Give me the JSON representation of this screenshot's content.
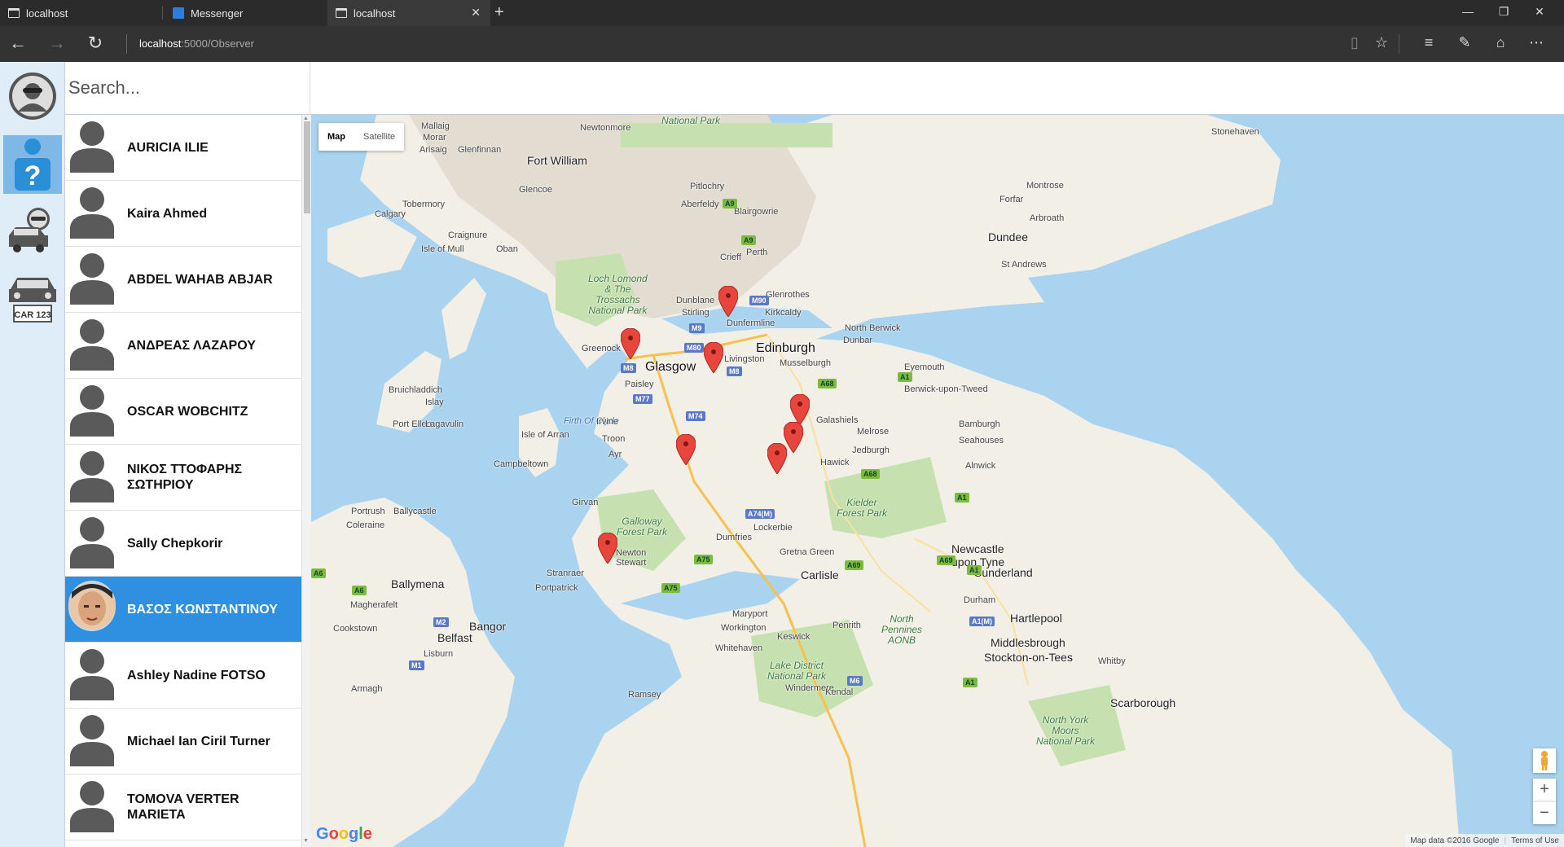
{
  "browser": {
    "tabs": [
      {
        "title": "localhost",
        "active": false
      },
      {
        "title": "Messenger",
        "active": false
      },
      {
        "title": "localhost",
        "active": true
      }
    ],
    "url_host": "localhost",
    "url_path": ":5000/Observer"
  },
  "search": {
    "placeholder": "Search..."
  },
  "rail": [
    {
      "icon": "masked-user-icon",
      "active": false
    },
    {
      "icon": "unknown-person-icon",
      "active": true
    },
    {
      "icon": "driver-car-icon",
      "active": false
    },
    {
      "icon": "car-plate-icon",
      "active": false,
      "plate": "CAR 123"
    }
  ],
  "people": [
    {
      "name": "AURICIA ILIE",
      "selected": false
    },
    {
      "name": "Kaira Ahmed",
      "selected": false
    },
    {
      "name": "ABDEL WAHAB ABJAR",
      "selected": false
    },
    {
      "name": "ΑΝΔΡΕΑΣ ΛΑΖΑΡΟΥ",
      "selected": false
    },
    {
      "name": "OSCAR WOBCHITZ",
      "selected": false
    },
    {
      "name": "ΝΙΚΟΣ ΤΤΟΦΑΡΗΣ ΣΩΤΗΡΙΟΥ",
      "selected": false
    },
    {
      "name": "Sally Chepkorir",
      "selected": false
    },
    {
      "name": "ΒΑΣΟΣ ΚΩΝΣΤΑΝΤΙΝΟΥ",
      "selected": true
    },
    {
      "name": "Ashley Nadine FOTSO",
      "selected": false
    },
    {
      "name": "Michael Ian Ciril Turner",
      "selected": false
    },
    {
      "name": "TOMOVA VERTER MARIETA",
      "selected": false
    }
  ],
  "map": {
    "type_buttons": [
      "Map",
      "Satellite"
    ],
    "active_type": "Map",
    "zoom_in": "+",
    "zoom_out": "−",
    "attribution": "Map data ©2016 Google",
    "terms": "Terms of Use",
    "logo": "Google",
    "colors": {
      "water": "#aad3f0",
      "land": "#f2efe6",
      "park": "#c7e0b0",
      "marker": "#e8453c",
      "selected": "#2f8fe0"
    }
  }
}
